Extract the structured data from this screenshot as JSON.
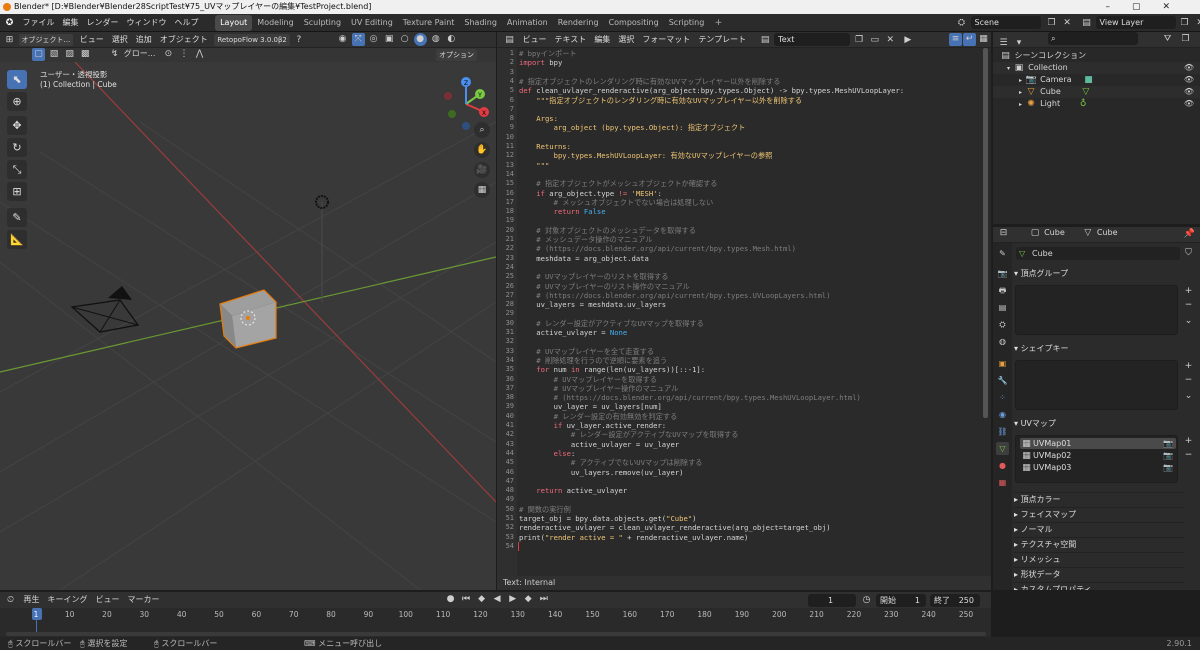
{
  "window": {
    "title": "Blender* [D:¥Blender¥Blender28ScriptTest¥75_UVマップレイヤーの編集¥TestProject.blend]"
  },
  "menus": [
    "ファイル",
    "編集",
    "レンダー",
    "ウィンドウ",
    "ヘルプ"
  ],
  "workspaces": [
    "Layout",
    "Modeling",
    "Sculpting",
    "UV Editing",
    "Texture Paint",
    "Shading",
    "Animation",
    "Rendering",
    "Compositing",
    "Scripting"
  ],
  "active_workspace": "Layout",
  "scene": {
    "label": "Scene",
    "view_layer": "View Layer"
  },
  "viewport": {
    "mode": "オブジェクト...",
    "menus": [
      "ビュー",
      "選択",
      "追加",
      "オブジェクト"
    ],
    "addon": "RetopoFlow 3.0.0β2",
    "orientation": "グロー...",
    "options": "オプション",
    "view_name": "ユーザー・透視投影",
    "collection_info": "(1) Collection | Cube",
    "gizmo": {
      "x": "X",
      "y": "Y",
      "z": "Z"
    }
  },
  "text_editor": {
    "menus": [
      "ビュー",
      "テキスト",
      "編集",
      "選択",
      "フォーマット",
      "テンプレート"
    ],
    "text_name": "Text",
    "footer": "Text: Internal",
    "lines": [
      [
        [
          "c",
          "# bpyインポート"
        ]
      ],
      [
        [
          "k",
          "import"
        ],
        [
          "t",
          " bpy"
        ]
      ],
      [
        [
          "t",
          ""
        ]
      ],
      [
        [
          "c",
          "# 指定オブジェクトのレンダリング時に有効なUVマップレイヤー以外を削除する"
        ]
      ],
      [
        [
          "k",
          "def"
        ],
        [
          "t",
          " clean_uvlayer_renderactive(arg_object:bpy.types.Object) -> bpy.types.MeshUVLoopLayer:"
        ]
      ],
      [
        [
          "s",
          "    \"\"\"指定オブジェクトのレンダリング時に有効なUVマップレイヤー以外を削除する"
        ]
      ],
      [
        [
          "t",
          ""
        ]
      ],
      [
        [
          "s",
          "    Args:"
        ]
      ],
      [
        [
          "s",
          "        arg_object (bpy.types.Object): 指定オブジェクト"
        ]
      ],
      [
        [
          "t",
          ""
        ]
      ],
      [
        [
          "s",
          "    Returns:"
        ]
      ],
      [
        [
          "s",
          "        bpy.types.MeshUVLoopLayer: 有効なUVマップレイヤーの参照"
        ]
      ],
      [
        [
          "s",
          "    \"\"\""
        ]
      ],
      [
        [
          "t",
          ""
        ]
      ],
      [
        [
          "c",
          "    # 指定オブジェクトがメッシュオブジェクトか確認する"
        ]
      ],
      [
        [
          "k",
          "    if"
        ],
        [
          "t",
          " arg_object.type "
        ],
        [
          "k",
          "!="
        ],
        [
          "s",
          " 'MESH'"
        ],
        [
          "t",
          ":"
        ]
      ],
      [
        [
          "c",
          "        # メッシュオブジェクトでない場合は処理しない"
        ]
      ],
      [
        [
          "k",
          "        return"
        ],
        [
          "n",
          " False"
        ]
      ],
      [
        [
          "t",
          ""
        ]
      ],
      [
        [
          "c",
          "    # 対象オブジェクトのメッシュデータを取得する"
        ]
      ],
      [
        [
          "c",
          "    # メッシュデータ操作のマニュアル"
        ]
      ],
      [
        [
          "c",
          "    # (https://docs.blender.org/api/current/bpy.types.Mesh.html)"
        ]
      ],
      [
        [
          "t",
          "    meshdata = arg_object.data"
        ]
      ],
      [
        [
          "t",
          ""
        ]
      ],
      [
        [
          "c",
          "    # UVマップレイヤーのリストを取得する"
        ]
      ],
      [
        [
          "c",
          "    # UVマップレイヤーのリスト操作のマニュアル"
        ]
      ],
      [
        [
          "c",
          "    # (https://docs.blender.org/api/current/bpy.types.UVLoopLayers.html)"
        ]
      ],
      [
        [
          "t",
          "    uv_layers = meshdata.uv_layers"
        ]
      ],
      [
        [
          "t",
          ""
        ]
      ],
      [
        [
          "c",
          "    # レンダー設定がアクティブなUVマップを取得する"
        ]
      ],
      [
        [
          "t",
          "    active_uvlayer = "
        ],
        [
          "n",
          "None"
        ]
      ],
      [
        [
          "t",
          ""
        ]
      ],
      [
        [
          "c",
          "    # UVマップレイヤーを全て走査する"
        ]
      ],
      [
        [
          "c",
          "    # 削除処理を行うので逆順に要素を追う"
        ]
      ],
      [
        [
          "k",
          "    for"
        ],
        [
          "t",
          " num "
        ],
        [
          "k",
          "in"
        ],
        [
          "t",
          " range(len(uv_layers))[::-1]:"
        ]
      ],
      [
        [
          "c",
          "        # UVマップレイヤーを取得する"
        ]
      ],
      [
        [
          "c",
          "        # UVマップレイヤー操作のマニュアル"
        ]
      ],
      [
        [
          "c",
          "        # (https://docs.blender.org/api/current/bpy.types.MeshUVLoopLayer.html)"
        ]
      ],
      [
        [
          "t",
          "        uv_layer = uv_layers[num]"
        ]
      ],
      [
        [
          "c",
          "        # レンダー設定の有効無効を判定する"
        ]
      ],
      [
        [
          "k",
          "        if"
        ],
        [
          "t",
          " uv_layer.active_render:"
        ]
      ],
      [
        [
          "c",
          "            # レンダー設定がアクティブなUVマップを取得する"
        ]
      ],
      [
        [
          "t",
          "            active_uvlayer = uv_layer"
        ]
      ],
      [
        [
          "k",
          "        else"
        ],
        [
          "t",
          ":"
        ]
      ],
      [
        [
          "c",
          "            # アクティブでないUVマップは削除する"
        ]
      ],
      [
        [
          "t",
          "            uv_layers.remove(uv_layer)"
        ]
      ],
      [
        [
          "t",
          ""
        ]
      ],
      [
        [
          "k",
          "    return"
        ],
        [
          "t",
          " active_uvlayer"
        ]
      ],
      [
        [
          "t",
          ""
        ]
      ],
      [
        [
          "c",
          "# 関数の実行例"
        ]
      ],
      [
        [
          "t",
          "target_obj = bpy.data.objects.get("
        ],
        [
          "s",
          "\"Cube\""
        ],
        [
          "t",
          ")"
        ]
      ],
      [
        [
          "t",
          "renderactive_uvlayer = clean_uvlayer_renderactive(arg_object=target_obj)"
        ]
      ],
      [
        [
          "t",
          "print("
        ],
        [
          "s",
          "\"render active = \""
        ],
        [
          "t",
          " + renderactive_uvlayer.name)"
        ]
      ],
      [
        [
          "t",
          ""
        ]
      ]
    ]
  },
  "outliner": {
    "root": "シーンコレクション",
    "collection": "Collection",
    "items": [
      "Camera",
      "Cube",
      "Light"
    ]
  },
  "properties": {
    "object_name": "Cube",
    "data_name": "Cube",
    "search_value": "Cube",
    "panels": {
      "vertex_groups": "頂点グループ",
      "shape_keys": "シェイプキー",
      "uv_maps": "UVマップ"
    },
    "uv_maps": [
      "UVMap01",
      "UVMap02",
      "UVMap03"
    ],
    "collapsed": [
      "頂点カラー",
      "フェイスマップ",
      "ノーマル",
      "テクスチャ空間",
      "リメッシュ",
      "形状データ",
      "カスタムプロパティ"
    ]
  },
  "timeline": {
    "menus": [
      "再生",
      "キーイング",
      "ビュー",
      "マーカー"
    ],
    "current_frame": "1",
    "start_label": "開始",
    "start": "1",
    "end_label": "終了",
    "end": "250",
    "ticks": [
      "1",
      "10",
      "20",
      "30",
      "40",
      "50",
      "60",
      "70",
      "80",
      "90",
      "100",
      "110",
      "120",
      "130",
      "140",
      "150",
      "160",
      "170",
      "180",
      "190",
      "200",
      "210",
      "220",
      "230",
      "240",
      "250"
    ]
  },
  "status": {
    "items": [
      "スクロールバー",
      "選択を設定",
      "スクロールバー",
      "メニュー呼び出し"
    ],
    "version": "2.90.1"
  },
  "colors": {
    "accent": "#4772b3",
    "selection": "#e87d0d",
    "x_axis": "#e03c44",
    "y_axis": "#7ac943",
    "z_axis": "#4b8ff0"
  }
}
